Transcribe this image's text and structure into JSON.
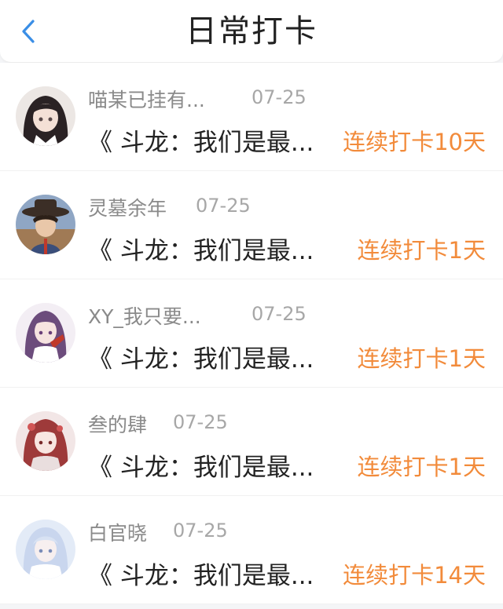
{
  "header": {
    "title": "日常打卡"
  },
  "colors": {
    "accent": "#f28b3b",
    "back": "#3a8ee6"
  },
  "items": [
    {
      "name": "喵某已挂有...",
      "date": "07-25",
      "book": "《 斗龙：我们是最...",
      "streak": "连续打卡10天",
      "avatar": "avatar-dark-hair"
    },
    {
      "name": "灵墓余年",
      "date": "07-25",
      "book": "《 斗龙：我们是最...",
      "streak": "连续打卡1天",
      "avatar": "avatar-hat-boy"
    },
    {
      "name": "XY_我只要...",
      "date": "07-25",
      "book": "《 斗龙：我们是最...",
      "streak": "连续打卡1天",
      "avatar": "avatar-purple-girl"
    },
    {
      "name": "叁的肆",
      "date": "07-25",
      "book": "《 斗龙：我们是最...",
      "streak": "连续打卡1天",
      "avatar": "avatar-red-girl"
    },
    {
      "name": "白官晓",
      "date": "07-25",
      "book": "《 斗龙：我们是最...",
      "streak": "连续打卡14天",
      "avatar": "avatar-white-girl"
    }
  ]
}
